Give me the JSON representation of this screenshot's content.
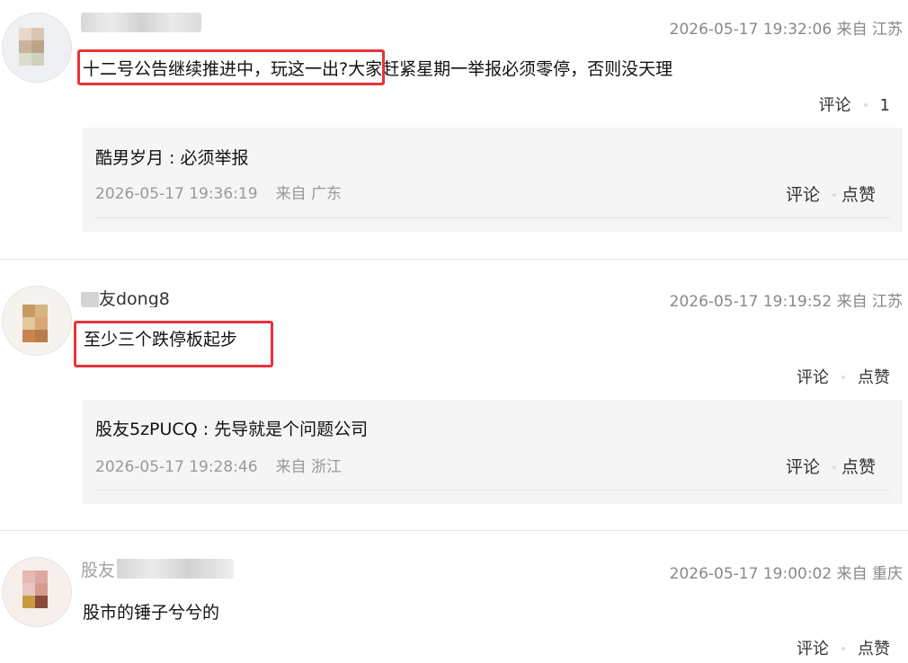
{
  "comments": [
    {
      "meta": "2026-05-17 19:32:06 来自 江苏",
      "content_highlight": "十二号公告继续推进中，玩这一出?",
      "content_rest": "大家赶紧星期一举报必须零停，否则没天理",
      "actions": {
        "comment": "评论",
        "like_count": "1"
      },
      "reply": {
        "author": "酷男岁月",
        "sep": " : ",
        "text": "必须举报",
        "time": "2026-05-17 19:36:19",
        "location": "来自 广东",
        "comment": "评论",
        "like": "点赞"
      }
    },
    {
      "username_visible": "友dong8",
      "meta": "2026-05-17 19:19:52 来自 江苏",
      "content_highlight": "至少三个跌停板起步",
      "actions": {
        "comment": "评论",
        "like": "点赞"
      },
      "reply": {
        "author": "股友5zPUCQ",
        "sep": " : ",
        "text": "先导就是个问题公司",
        "time": "2026-05-17 19:28:46",
        "location": "来自 浙江",
        "comment": "评论",
        "like": "点赞"
      }
    },
    {
      "username_visible": "股友",
      "meta": "2026-05-17 19:00:02 来自 重庆",
      "content": "股市的锤子兮兮的",
      "actions": {
        "comment": "评论",
        "like": "点赞"
      }
    }
  ],
  "colors": {
    "highlight_border": "#e8333a",
    "reply_bg": "#f5f5f5",
    "meta": "#888888"
  }
}
